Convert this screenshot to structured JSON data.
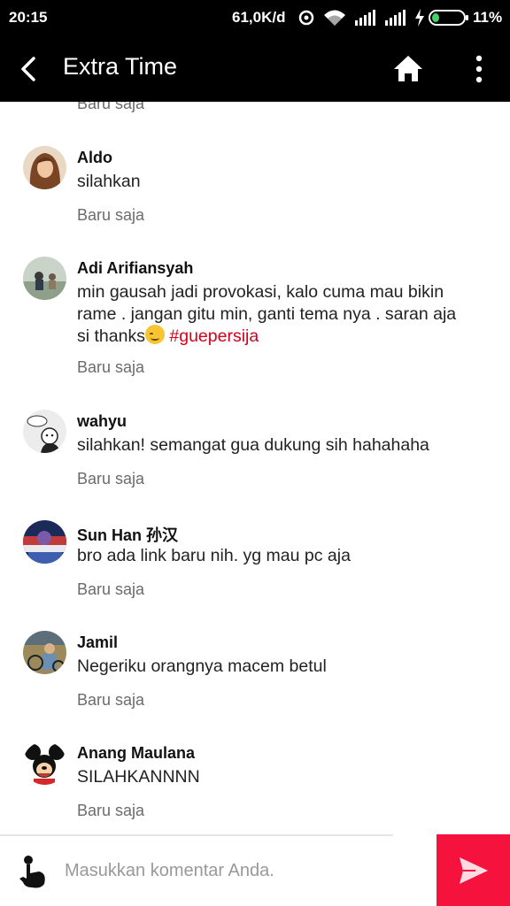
{
  "status_bar": {
    "time": "20:15",
    "network_rate": "61,0K/d",
    "battery_percent": "11%",
    "icons": [
      "sync-icon",
      "wifi-icon",
      "signal-icon",
      "signal-icon",
      "charging-icon",
      "battery-icon"
    ]
  },
  "app_bar": {
    "title": "Extra Time",
    "icons": [
      "back-arrow-icon",
      "home-icon",
      "more-vert-icon"
    ]
  },
  "top_partial_time": "Baru saja",
  "comments": [
    {
      "name": "Aldo",
      "text": "silahkan",
      "time": "Baru saja"
    },
    {
      "name": "Adi Arifiansyah",
      "text_lines": [
        "min gausah jadi provokasi, kalo cuma mau bikin",
        "rame . jangan gitu min, ganti tema nya . saran aja",
        "si thanks"
      ],
      "hashtag": "#guepersija",
      "time": "Baru saja"
    },
    {
      "name": "wahyu",
      "text": "silahkan! semangat gua dukung sih hahahaha",
      "time": "Baru saja"
    },
    {
      "name": "Sun Han 孙汉",
      "text": "bro ada link baru nih. yg mau pc aja",
      "time": "Baru saja"
    },
    {
      "name": "Jamil",
      "text": "Negeriku orangnya macem betul",
      "time": "Baru saja"
    },
    {
      "name": "Anang Maulana",
      "text": "SILAHKANNNN",
      "time": "Baru saja"
    }
  ],
  "comment_input": {
    "placeholder": "Masukkan komentar Anda."
  },
  "colors": {
    "header_bg": "#000000",
    "send_button": "#f5123d",
    "hashtag": "#d4001a",
    "timestamp": "#6b6b6b"
  }
}
